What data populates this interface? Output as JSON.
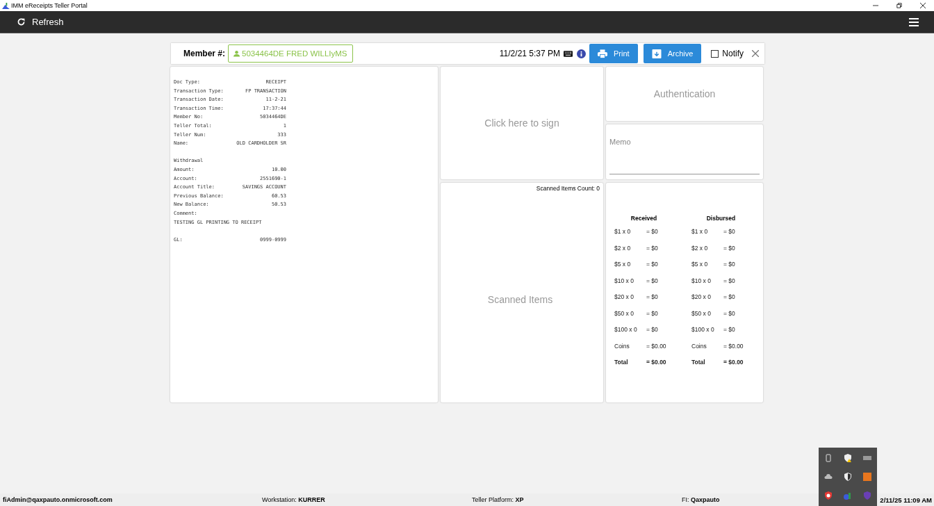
{
  "window": {
    "title": "IMM eReceipts Teller Portal"
  },
  "toolbar": {
    "refresh": "Refresh"
  },
  "member": {
    "label": "Member #:",
    "value": "5034464DE FRED WILLIyMS",
    "datetime": "11/2/21 5:37 PM",
    "print": "Print",
    "archive": "Archive",
    "notify": {
      "label": "Notify",
      "checked": false
    }
  },
  "receipt": [
    {
      "kind": "pair",
      "label": "Doc Type:",
      "value": "RECEIPT"
    },
    {
      "kind": "pair",
      "label": "Transaction Type:",
      "value": "FP TRANSACTION"
    },
    {
      "kind": "pair",
      "label": "Transaction Date:",
      "value": "11-2-21"
    },
    {
      "kind": "pair",
      "label": "Transaction Time:",
      "value": "17:37:44"
    },
    {
      "kind": "pair",
      "label": "Member No:",
      "value": "5034464DE"
    },
    {
      "kind": "pair",
      "label": "Teller Total:",
      "value": "1"
    },
    {
      "kind": "pair",
      "label": "Teller Num:",
      "value": "333"
    },
    {
      "kind": "pair",
      "label": "Name:",
      "value": "OLD CARDHOLDER SR"
    },
    {
      "kind": "gap"
    },
    {
      "kind": "text",
      "label": "Withdrawal"
    },
    {
      "kind": "pair",
      "label": "Amount:",
      "value": "10.00"
    },
    {
      "kind": "pair",
      "label": "Account:",
      "value": "2551690-1"
    },
    {
      "kind": "pair",
      "label": "Account Title:",
      "value": "SAVINGS ACCOUNT"
    },
    {
      "kind": "pair",
      "label": "Previous Balance:",
      "value": "60.53"
    },
    {
      "kind": "pair",
      "label": "New Balance:",
      "value": "50.53"
    },
    {
      "kind": "text",
      "label": "Comment:"
    },
    {
      "kind": "text",
      "label": "TESTING GL PRINTING TO RECEIPT"
    },
    {
      "kind": "gap"
    },
    {
      "kind": "pair",
      "label": "GL:",
      "value": "0999-0999"
    }
  ],
  "signature": {
    "prompt": "Click here to sign"
  },
  "scanned": {
    "count": "Scanned Items Count: 0",
    "placeholder": "Scanned Items"
  },
  "authentication": {
    "label": "Authentication"
  },
  "memo": {
    "placeholder": "Memo"
  },
  "cash": [
    {
      "heading": "Received",
      "rows": [
        {
          "kind": "line",
          "label": "$1 x 0",
          "amount": "= $0"
        },
        {
          "kind": "line",
          "label": "$2 x 0",
          "amount": "= $0"
        },
        {
          "kind": "line",
          "label": "$5 x 0",
          "amount": "= $0"
        },
        {
          "kind": "line",
          "label": "$10 x 0",
          "amount": "= $0"
        },
        {
          "kind": "line",
          "label": "$20 x 0",
          "amount": "= $0"
        },
        {
          "kind": "line",
          "label": "$50 x 0",
          "amount": "= $0"
        },
        {
          "kind": "line",
          "label": "$100 x 0",
          "amount": "= $0"
        },
        {
          "kind": "line",
          "label": "Coins",
          "amount": "= $0.00"
        },
        {
          "kind": "total",
          "label": "Total",
          "amount": "= $0.00"
        }
      ]
    },
    {
      "heading": "Disbursed",
      "rows": [
        {
          "kind": "line",
          "label": "$1 x 0",
          "amount": "= $0"
        },
        {
          "kind": "line",
          "label": "$2 x 0",
          "amount": "= $0"
        },
        {
          "kind": "line",
          "label": "$5 x 0",
          "amount": "= $0"
        },
        {
          "kind": "line",
          "label": "$10 x 0",
          "amount": "= $0"
        },
        {
          "kind": "line",
          "label": "$20 x 0",
          "amount": "= $0"
        },
        {
          "kind": "line",
          "label": "$50 x 0",
          "amount": "= $0"
        },
        {
          "kind": "line",
          "label": "$100 x 0",
          "amount": "= $0"
        },
        {
          "kind": "line",
          "label": "Coins",
          "amount": "= $0.00"
        },
        {
          "kind": "total",
          "label": "Total",
          "amount": "= $0.00"
        }
      ]
    }
  ],
  "status_bar": {
    "user": "fiAdmin@qaxpauto.onmicrosoft.com",
    "items": [
      {
        "label": "Workstation:",
        "value": "KURRER"
      },
      {
        "label": "Teller Platform:",
        "value": "XP"
      },
      {
        "label": "FI:",
        "value": "Qaxpauto"
      }
    ],
    "clock": "2/11/25 11:09 AM"
  }
}
